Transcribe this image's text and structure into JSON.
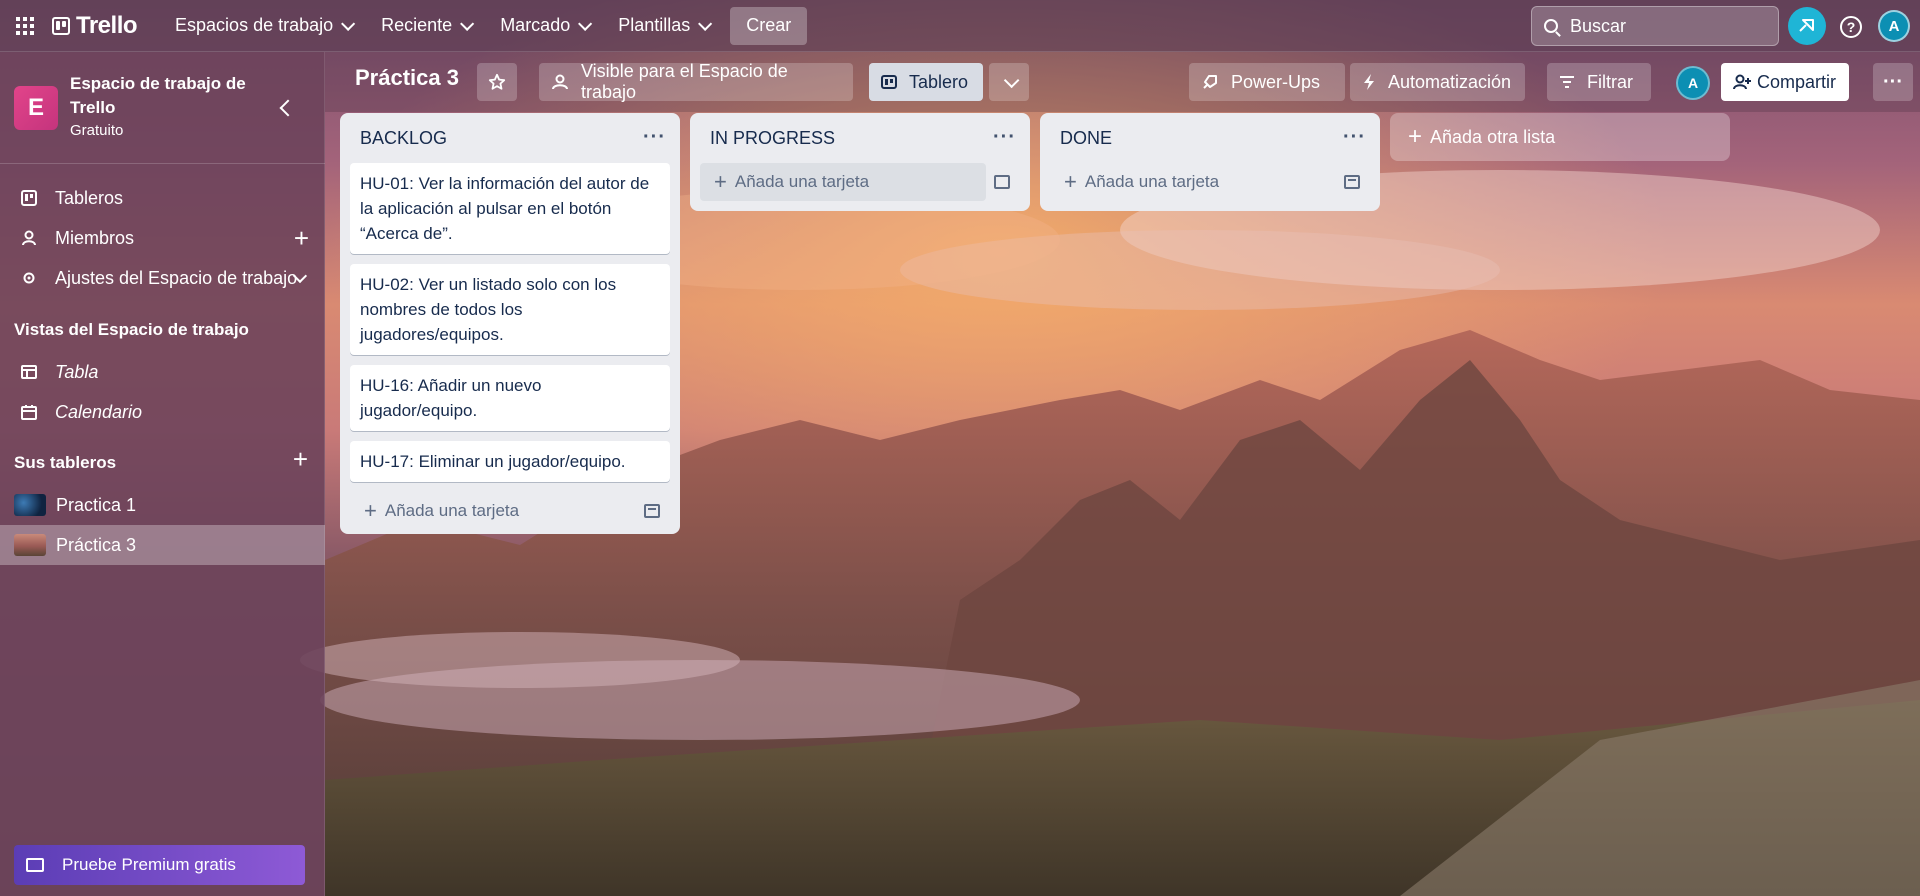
{
  "topbar": {
    "logo": "Trello",
    "nav": [
      {
        "label": "Espacios de trabajo"
      },
      {
        "label": "Reciente"
      },
      {
        "label": "Marcado"
      },
      {
        "label": "Plantillas"
      }
    ],
    "create": "Crear",
    "search_placeholder": "Buscar",
    "avatar_initial": "A"
  },
  "sidebar": {
    "workspace_initial": "E",
    "workspace_name": "Espacio de trabajo de Trello",
    "workspace_plan": "Gratuito",
    "items": [
      {
        "label": "Tableros"
      },
      {
        "label": "Miembros"
      },
      {
        "label": "Ajustes del Espacio de trabajo"
      }
    ],
    "views_title": "Vistas del Espacio de trabajo",
    "views": [
      {
        "label": "Tabla"
      },
      {
        "label": "Calendario"
      }
    ],
    "boards_title": "Sus tableros",
    "boards": [
      {
        "label": "Practica 1"
      },
      {
        "label": "Práctica 3"
      }
    ],
    "premium": "Pruebe Premium gratis"
  },
  "board": {
    "title": "Práctica 3",
    "visibility": "Visible para el Espacio de trabajo",
    "view": "Tablero",
    "powerups": "Power-Ups",
    "automation": "Automatización",
    "filter": "Filtrar",
    "avatar_initial": "A",
    "share": "Compartir"
  },
  "lists": [
    {
      "title": "BACKLOG",
      "cards": [
        "HU-01: Ver la información del autor de la aplicación al pulsar en el botón “Acerca de”.",
        "HU-02: Ver un listado solo con los nombres de todos los jugadores/equipos.",
        "HU-16: Añadir un nuevo jugador/equipo.",
        "HU-17: Eliminar un jugador/equipo."
      ],
      "add_card": "Añada una tarjeta"
    },
    {
      "title": "IN PROGRESS",
      "cards": [],
      "add_card": "Añada una tarjeta"
    },
    {
      "title": "DONE",
      "cards": [],
      "add_card": "Añada una tarjeta"
    }
  ],
  "add_list": "Añada otra lista",
  "colors": {
    "list_bg": "#ebecf0",
    "accent": "#1fb5d6",
    "workspace_avatar": "#e2448a",
    "premium": "#8e5ad6"
  }
}
